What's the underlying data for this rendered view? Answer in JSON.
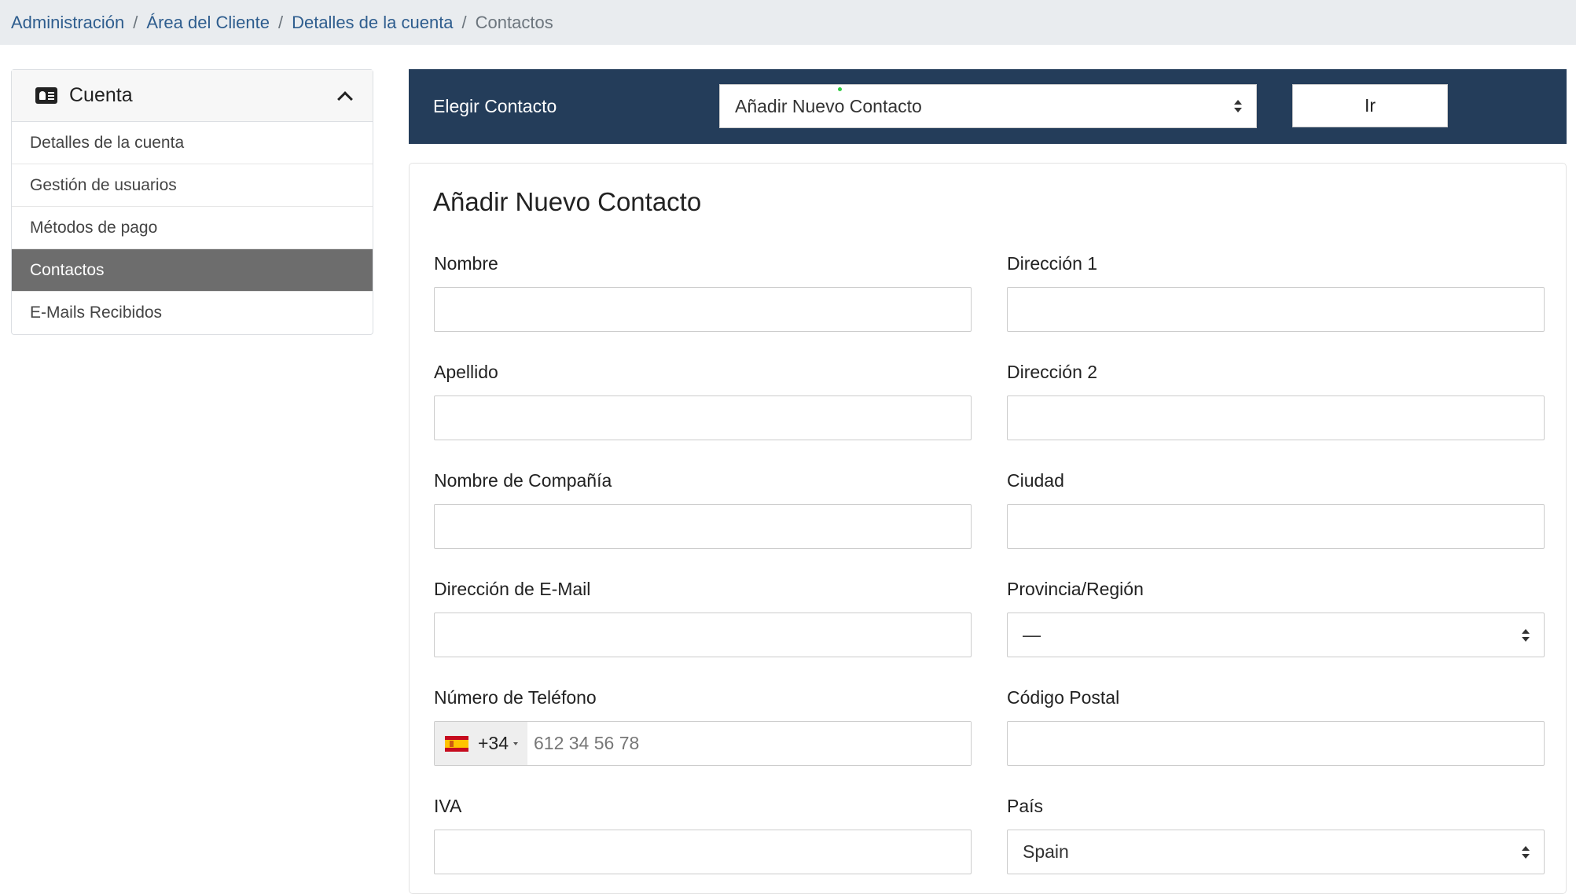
{
  "breadcrumb": {
    "items": [
      "Administración",
      "Área del Cliente",
      "Detalles de la cuenta"
    ],
    "separator": "/",
    "current": "Contactos"
  },
  "sidebar": {
    "title": "Cuenta",
    "title_icon": "id-card-icon",
    "collapse_icon": "chevron-up-icon",
    "items": [
      {
        "label": "Detalles de la cuenta",
        "active": false
      },
      {
        "label": "Gestión de usuarios",
        "active": false
      },
      {
        "label": "Métodos de pago",
        "active": false
      },
      {
        "label": "Contactos",
        "active": true
      },
      {
        "label": "E-Mails Recibidos",
        "active": false
      }
    ]
  },
  "chooser": {
    "label": "Elegir Contacto",
    "selected": "Añadir Nuevo Contacto",
    "go_label": "Ir"
  },
  "form": {
    "title": "Añadir Nuevo Contacto",
    "first_name": {
      "label": "Nombre",
      "value": ""
    },
    "last_name": {
      "label": "Apellido",
      "value": ""
    },
    "company": {
      "label": "Nombre de Compañía",
      "value": ""
    },
    "email": {
      "label": "Dirección de E-Mail",
      "value": ""
    },
    "phone": {
      "label": "Número de Teléfono",
      "dial_code": "+34",
      "country_flag": "spain-flag-icon",
      "placeholder": "612 34 56 78",
      "value": ""
    },
    "vat": {
      "label": "IVA",
      "value": ""
    },
    "address1": {
      "label": "Dirección 1",
      "value": ""
    },
    "address2": {
      "label": "Dirección 2",
      "value": ""
    },
    "city": {
      "label": "Ciudad",
      "value": ""
    },
    "state": {
      "label": "Provincia/Región",
      "selected": "—"
    },
    "postcode": {
      "label": "Código Postal",
      "value": ""
    },
    "country": {
      "label": "País",
      "selected": "Spain"
    }
  },
  "colors": {
    "chooser_bar": "#243d5a",
    "active_item": "#6d6d6d",
    "link": "#2e5d8e",
    "breadcrumb_bg": "#e9ecef"
  }
}
